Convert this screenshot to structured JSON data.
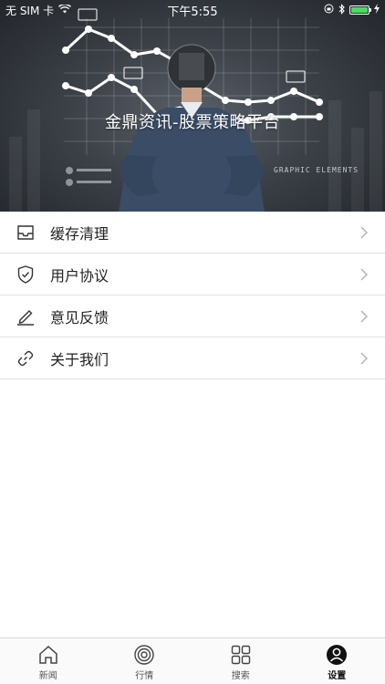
{
  "status_bar": {
    "carrier": "无 SIM 卡",
    "time": "下午5:55",
    "battery_level": 1.0
  },
  "banner": {
    "title": "金鼎资讯-股票策略平台",
    "graphic_text": "GRAPHIC ELEMENTS"
  },
  "menu": {
    "items": [
      {
        "label": "缓存清理",
        "icon": "inbox-icon"
      },
      {
        "label": "用户协议",
        "icon": "shield-check-icon"
      },
      {
        "label": "意见反馈",
        "icon": "pencil-icon"
      },
      {
        "label": "关于我们",
        "icon": "link-icon"
      }
    ]
  },
  "tabbar": {
    "tabs": [
      {
        "label": "新闻",
        "icon": "home-icon",
        "active": false
      },
      {
        "label": "行情",
        "icon": "target-icon",
        "active": false
      },
      {
        "label": "搜索",
        "icon": "grid-icon",
        "active": false
      },
      {
        "label": "设置",
        "icon": "user-icon",
        "active": true
      }
    ]
  },
  "colors": {
    "battery": "#4cd964",
    "divider": "#e2e2e2",
    "text": "#222222"
  }
}
